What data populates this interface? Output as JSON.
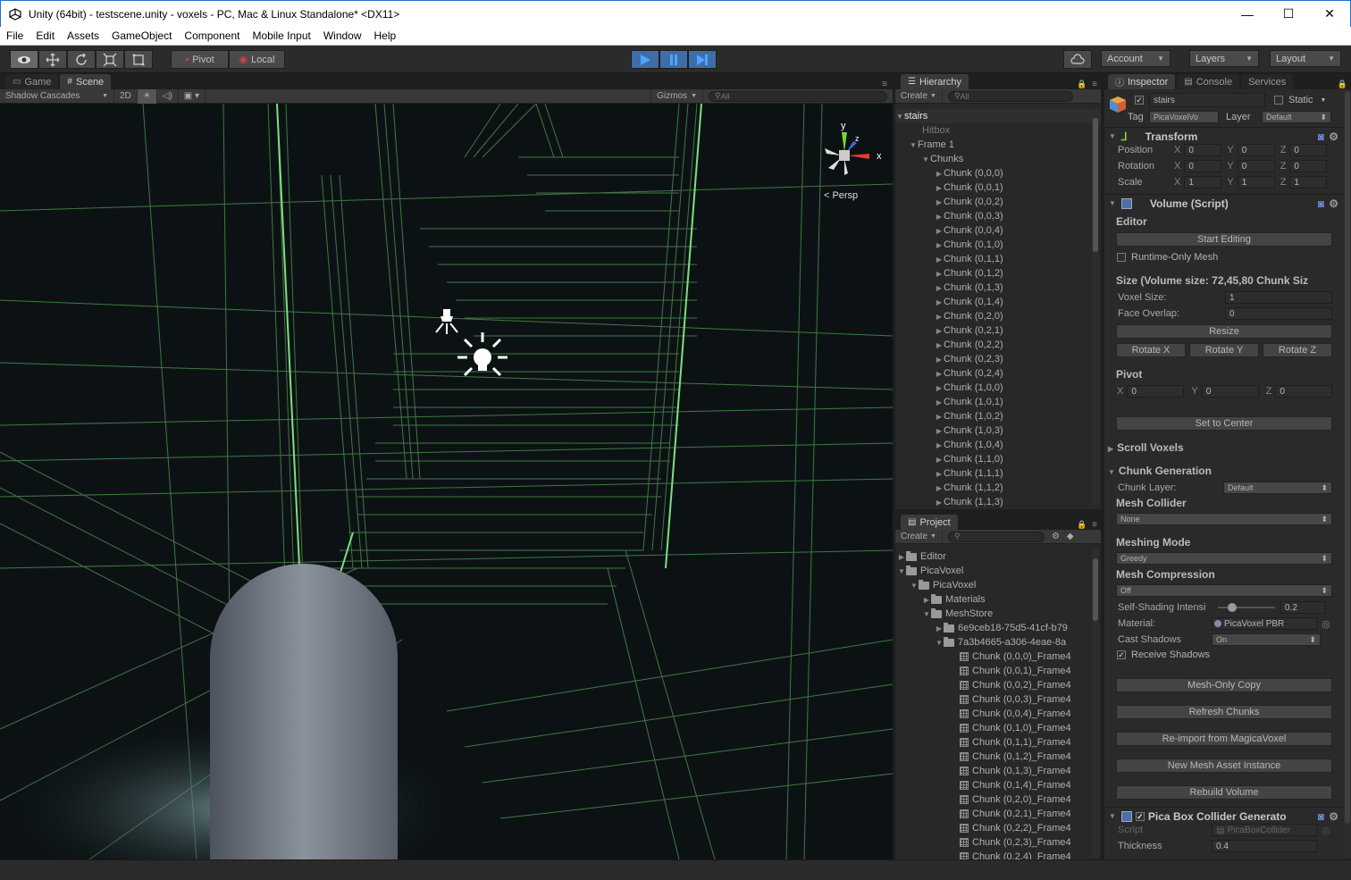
{
  "window": {
    "title": "Unity (64bit) - testscene.unity - voxels - PC, Mac & Linux Standalone* <DX11>",
    "minimize": "—",
    "maximize": "☐",
    "close": "✕"
  },
  "menu": [
    "File",
    "Edit",
    "Assets",
    "GameObject",
    "Component",
    "Mobile Input",
    "Window",
    "Help"
  ],
  "toolbar": {
    "pivot": "Pivot",
    "local": "Local",
    "account": "Account",
    "layers": "Layers",
    "layout": "Layout"
  },
  "scene": {
    "tabs": {
      "game": "Game",
      "scene": "Scene"
    },
    "shading": "Shadow Cascades",
    "mode2d": "2D",
    "gizmos": "Gizmos",
    "search": "All",
    "persp": "Persp",
    "axis_y": "y",
    "axis_x": "x",
    "axis_z": "z"
  },
  "hierarchy": {
    "tab": "Hierarchy",
    "create": "Create",
    "search": "All",
    "root": "stairs",
    "hitbox": "Hitbox",
    "frame": "Frame 1",
    "chunks_label": "Chunks",
    "chunks": [
      "Chunk (0,0,0)",
      "Chunk (0,0,1)",
      "Chunk (0,0,2)",
      "Chunk (0,0,3)",
      "Chunk (0,0,4)",
      "Chunk (0,1,0)",
      "Chunk (0,1,1)",
      "Chunk (0,1,2)",
      "Chunk (0,1,3)",
      "Chunk (0,1,4)",
      "Chunk (0,2,0)",
      "Chunk (0,2,1)",
      "Chunk (0,2,2)",
      "Chunk (0,2,3)",
      "Chunk (0,2,4)",
      "Chunk (1,0,0)",
      "Chunk (1,0,1)",
      "Chunk (1,0,2)",
      "Chunk (1,0,3)",
      "Chunk (1,0,4)",
      "Chunk (1,1,0)",
      "Chunk (1,1,1)",
      "Chunk (1,1,2)",
      "Chunk (1,1,3)"
    ]
  },
  "project": {
    "tab": "Project",
    "create": "Create",
    "folders": {
      "editor": "Editor",
      "picavoxel": "PicaVoxel",
      "picavoxel2": "PicaVoxel",
      "materials": "Materials",
      "meshstore": "MeshStore",
      "guid1": "6e9ceb18-75d5-41cf-b79",
      "guid2": "7a3b4665-a306-4eae-8a"
    },
    "assets": [
      "Chunk (0,0,0)_Frame4",
      "Chunk (0,0,1)_Frame4",
      "Chunk (0,0,2)_Frame4",
      "Chunk (0,0,3)_Frame4",
      "Chunk (0,0,4)_Frame4",
      "Chunk (0,1,0)_Frame4",
      "Chunk (0,1,1)_Frame4",
      "Chunk (0,1,2)_Frame4",
      "Chunk (0,1,3)_Frame4",
      "Chunk (0,1,4)_Frame4",
      "Chunk (0,2,0)_Frame4",
      "Chunk (0,2,1)_Frame4",
      "Chunk (0,2,2)_Frame4",
      "Chunk (0,2,3)_Frame4",
      "Chunk (0,2,4)_Frame4"
    ]
  },
  "inspector": {
    "tabs": {
      "inspector": "Inspector",
      "console": "Console",
      "services": "Services"
    },
    "object_name": "stairs",
    "static": "Static",
    "tag_label": "Tag",
    "tag_value": "PicaVoxelVo",
    "layer_label": "Layer",
    "layer_value": "Default",
    "transform": {
      "title": "Transform",
      "position": {
        "label": "Position",
        "x": "0",
        "y": "0",
        "z": "0"
      },
      "rotation": {
        "label": "Rotation",
        "x": "0",
        "y": "0",
        "z": "0"
      },
      "scale": {
        "label": "Scale",
        "x": "1",
        "y": "1",
        "z": "1"
      }
    },
    "volume": {
      "title": "Volume (Script)",
      "editor_head": "Editor",
      "start_editing": "Start Editing",
      "runtime_only": "Runtime-Only Mesh",
      "size_head": "Size (Volume size: 72,45,80 Chunk Siz",
      "voxel_size_label": "Voxel Size:",
      "voxel_size": "1",
      "face_overlap_label": "Face Overlap:",
      "face_overlap": "0",
      "resize": "Resize",
      "rotate_x": "Rotate X",
      "rotate_y": "Rotate Y",
      "rotate_z": "Rotate Z",
      "pivot_head": "Pivot",
      "pivot": {
        "x": "0",
        "y": "0",
        "z": "0"
      },
      "set_to_center": "Set to Center",
      "scroll_voxels": "Scroll Voxels",
      "chunk_generation": "Chunk Generation",
      "chunk_layer_label": "Chunk Layer:",
      "chunk_layer": "Default",
      "mesh_collider_head": "Mesh Collider",
      "mesh_collider": "None",
      "meshing_mode_head": "Meshing Mode",
      "meshing_mode": "Greedy",
      "mesh_compression_head": "Mesh Compression",
      "mesh_compression": "Off",
      "self_shading_label": "Self-Shading Intensi",
      "self_shading": "0.2",
      "self_shading_fraction": 0.2,
      "material_label": "Material:",
      "material": "PicaVoxel PBR",
      "cast_shadows_label": "Cast Shadows",
      "cast_shadows": "On",
      "receive_shadows": "Receive Shadows",
      "mesh_only_copy": "Mesh-Only Copy",
      "refresh_chunks": "Refresh Chunks",
      "reimport": "Re-import from MagicaVoxel",
      "new_mesh_asset": "New Mesh Asset Instance",
      "rebuild_volume": "Rebuild Volume"
    },
    "collider_gen": {
      "title": "Pica Box Collider Generato",
      "script_label": "Script",
      "script": "PicaBoxCollider",
      "thickness_label": "Thickness",
      "thickness": "0.4"
    }
  }
}
